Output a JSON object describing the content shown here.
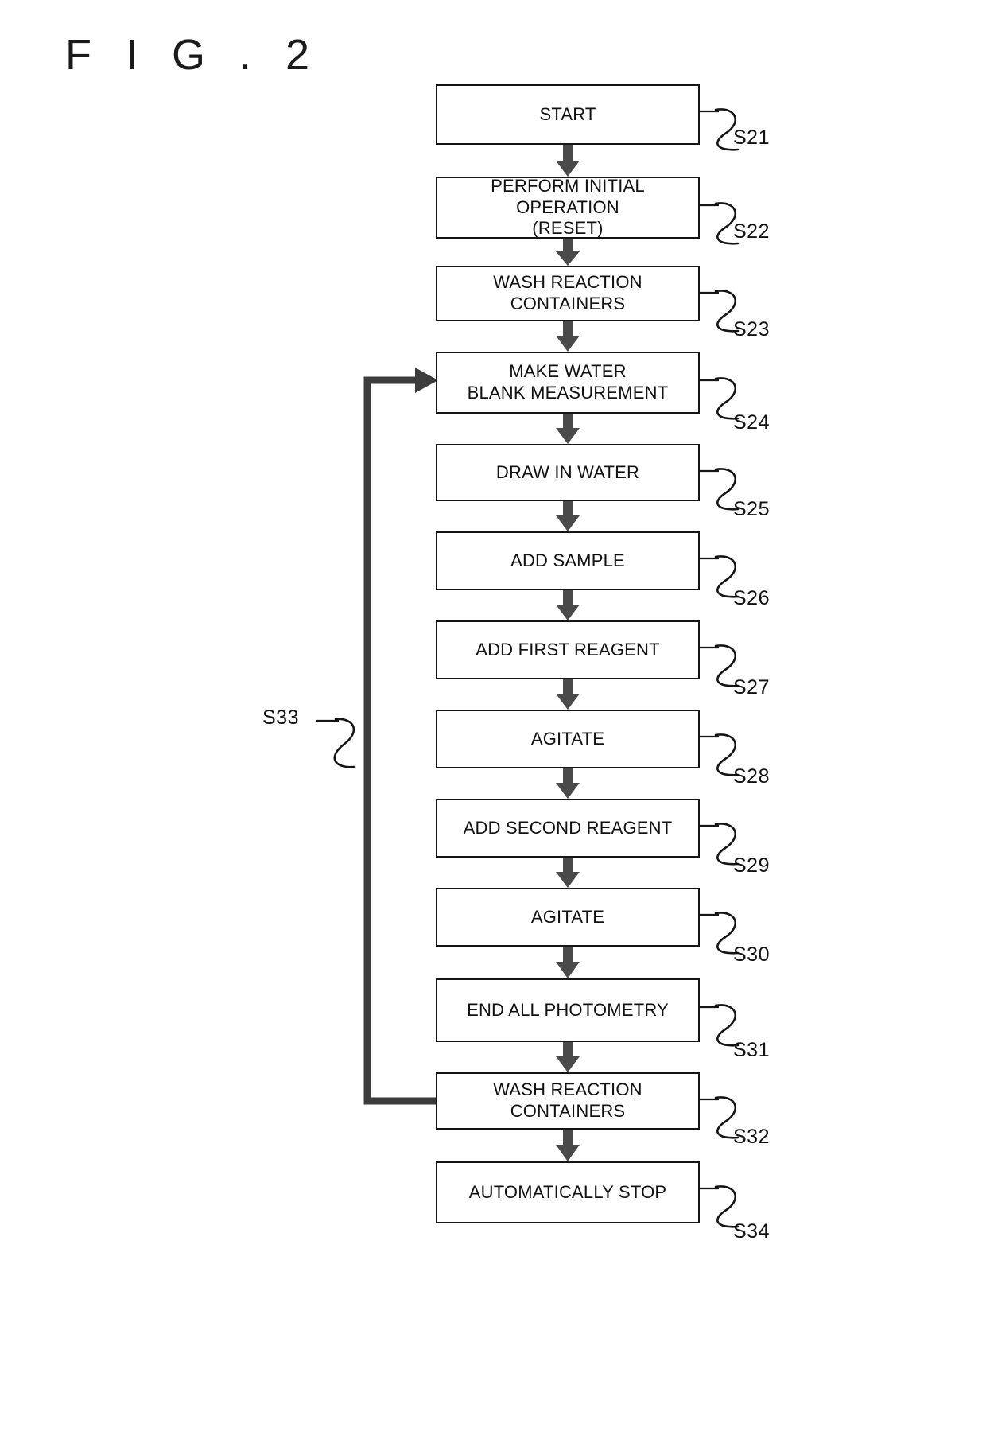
{
  "figure": {
    "title": "F I G . 2",
    "type": "flowchart"
  },
  "colors": {
    "box_border": "#151515",
    "arrow_fill": "#4a4a4a",
    "loop_line": "#3c3c3c",
    "text": "#111111",
    "background": "#ffffff"
  },
  "chart_data": {
    "type": "flowchart",
    "title": "F I G . 2",
    "orientation": "top-to-bottom",
    "nodes": [
      {
        "id": "S21",
        "label": "START",
        "step": "S21"
      },
      {
        "id": "S22",
        "label": "PERFORM INITIAL OPERATION\n(RESET)",
        "step": "S22"
      },
      {
        "id": "S23",
        "label": "WASH REACTION CONTAINERS",
        "step": "S23"
      },
      {
        "id": "S24",
        "label": "MAKE WATER\nBLANK MEASUREMENT",
        "step": "S24"
      },
      {
        "id": "S25",
        "label": "DRAW IN WATER",
        "step": "S25"
      },
      {
        "id": "S26",
        "label": "ADD SAMPLE",
        "step": "S26"
      },
      {
        "id": "S27",
        "label": "ADD FIRST REAGENT",
        "step": "S27"
      },
      {
        "id": "S28",
        "label": "AGITATE",
        "step": "S28"
      },
      {
        "id": "S29",
        "label": "ADD SECOND REAGENT",
        "step": "S29"
      },
      {
        "id": "S30",
        "label": "AGITATE",
        "step": "S30"
      },
      {
        "id": "S31",
        "label": "END ALL PHOTOMETRY",
        "step": "S31"
      },
      {
        "id": "S32",
        "label": "WASH REACTION CONTAINERS",
        "step": "S32"
      },
      {
        "id": "S34",
        "label": "AUTOMATICALLY STOP",
        "step": "S34"
      }
    ],
    "edges": [
      {
        "from": "S21",
        "to": "S22",
        "style": "block-arrow"
      },
      {
        "from": "S22",
        "to": "S23",
        "style": "block-arrow"
      },
      {
        "from": "S23",
        "to": "S24",
        "style": "block-arrow"
      },
      {
        "from": "S24",
        "to": "S25",
        "style": "block-arrow"
      },
      {
        "from": "S25",
        "to": "S26",
        "style": "block-arrow"
      },
      {
        "from": "S26",
        "to": "S27",
        "style": "block-arrow"
      },
      {
        "from": "S27",
        "to": "S28",
        "style": "block-arrow"
      },
      {
        "from": "S28",
        "to": "S29",
        "style": "block-arrow"
      },
      {
        "from": "S29",
        "to": "S30",
        "style": "block-arrow"
      },
      {
        "from": "S30",
        "to": "S31",
        "style": "block-arrow"
      },
      {
        "from": "S31",
        "to": "S32",
        "style": "block-arrow"
      },
      {
        "from": "S32",
        "to": "S34",
        "style": "block-arrow"
      },
      {
        "from": "S32",
        "to": "S24",
        "style": "feedback-loop",
        "label": "S33"
      }
    ],
    "feedback_label": "S33"
  },
  "steps": {
    "s21": "S21",
    "s22": "S22",
    "s23": "S23",
    "s24": "S24",
    "s25": "S25",
    "s26": "S26",
    "s27": "S27",
    "s28": "S28",
    "s29": "S29",
    "s30": "S30",
    "s31": "S31",
    "s32": "S32",
    "s33": "S33",
    "s34": "S34"
  },
  "boxes": {
    "b1": "START",
    "b2": "PERFORM INITIAL OPERATION\n(RESET)",
    "b3": "WASH REACTION CONTAINERS",
    "b4": "MAKE WATER\nBLANK MEASUREMENT",
    "b5": "DRAW IN WATER",
    "b6": "ADD SAMPLE",
    "b7": "ADD FIRST REAGENT",
    "b8": "AGITATE",
    "b9": "ADD SECOND REAGENT",
    "b10": "AGITATE",
    "b11": "END ALL PHOTOMETRY",
    "b12": "WASH REACTION CONTAINERS",
    "b13": "AUTOMATICALLY STOP"
  }
}
